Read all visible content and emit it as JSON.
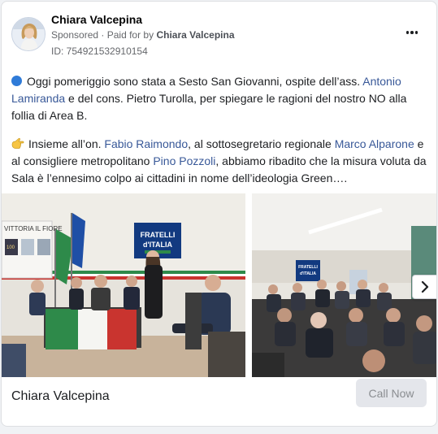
{
  "ad": {
    "page_name": "Chiara Valcepina",
    "sponsored_label": "Sponsored",
    "paid_for_prefix": "Paid for by",
    "paid_for_name": "Chiara Valcepina",
    "id_label": "ID: 754921532910154"
  },
  "post": {
    "p1": {
      "t1": "Oggi pomeriggio sono stata a Sesto San Giovanni, ospite dell’ass. ",
      "l1": "Antonio Lamiranda",
      "t2": " e del cons. Pietro Turolla, per spiegare le ragioni del nostro NO alla follia di Area B."
    },
    "p2": {
      "t1": "Insieme all’on. ",
      "l1": "Fabio Raimondo",
      "t2": ", al sottosegretario regionale ",
      "l2": "Marco Alparone",
      "t3": " e al consigliere metropolitano ",
      "l3": "Pino Pozzoli",
      "t4": ", abbiamo ribadito che la misura voluta da Sala è l’ennesimo colpo ai cittadini in nome dell’ideologia Green…."
    }
  },
  "photo1": {
    "banner_text": "VITTORIA IL FIORE",
    "sign_line1": "FRATELLI",
    "sign_line2": "d'ITALIA",
    "poster_text": "100"
  },
  "photo2": {
    "sign_line1": "FRATELLI",
    "sign_line2": "d'ITALIA"
  },
  "footer": {
    "name": "Chiara Valcepina",
    "cta_label": "Call Now"
  },
  "colors": {
    "link": "#385898",
    "accent_blue": "#2f7bd8",
    "cta_bg": "#e4e6eb"
  },
  "icons": {
    "blue_circle": "blue-circle-emoji-icon",
    "hand": "pointing-hand-emoji-icon",
    "more": "more-options-icon",
    "next": "chevron-right-icon"
  }
}
